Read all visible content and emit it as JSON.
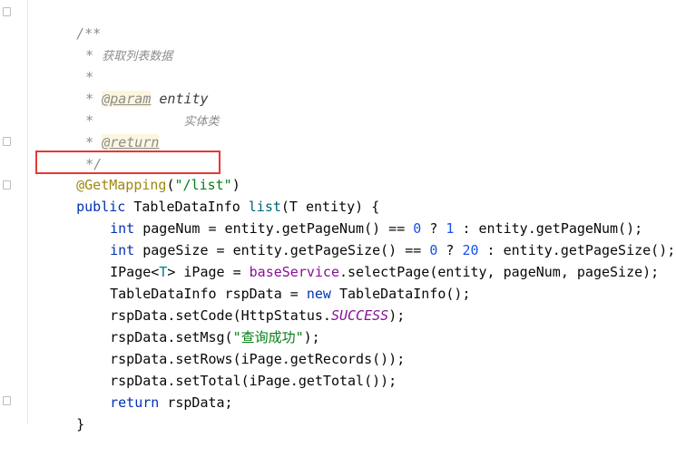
{
  "javadoc": {
    "open": "/**",
    "star": "*",
    "description": "获取列表数据",
    "param_tag": "@param",
    "param_name": "entity",
    "param_desc": "实体类",
    "return_tag": "@return",
    "close": "*/"
  },
  "annotation": {
    "name": "@GetMapping",
    "paren_open": "(",
    "path": "\"/list\"",
    "paren_close": ")"
  },
  "code": {
    "sig": {
      "kw": "public",
      "type": "TableDataInfo",
      "method": "list",
      "rest": "(T entity) {"
    },
    "l1": {
      "kw": "int",
      "a": " pageNum = entity.getPageNum() == ",
      "n1": "0",
      "b": " ? ",
      "n2": "1",
      "c": " : entity.getPageNum();"
    },
    "l2": {
      "kw": "int",
      "a": " pageSize = entity.getPageSize() == ",
      "n1": "0",
      "b": " ? ",
      "n2": "20",
      "c": " : entity.getPageSize();"
    },
    "l3": {
      "a": "IPage<",
      "t": "T",
      "b": "> iPage = ",
      "field": "baseService",
      "c": ".selectPage(entity, pageNum, pageSize);"
    },
    "l4": {
      "a": "TableDataInfo rspData = ",
      "kw": "new",
      "b": " TableDataInfo();"
    },
    "l5": {
      "a": "rspData.setCode(HttpStatus.",
      "const": "SUCCESS",
      "b": ");"
    },
    "l6": {
      "a": "rspData.setMsg(",
      "str": "\"查询成功\"",
      "b": ");"
    },
    "l7": {
      "a": "rspData.setRows(iPage.getRecords());"
    },
    "l8": {
      "a": "rspData.setTotal(iPage.getTotal());"
    },
    "l9": {
      "kw": "return",
      "a": " rspData;"
    },
    "close": "}"
  }
}
